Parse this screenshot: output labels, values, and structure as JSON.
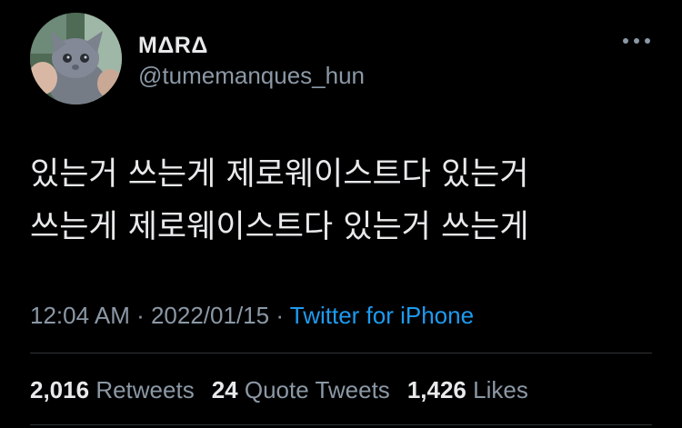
{
  "user": {
    "display_name": "MΔRΔ",
    "handle": "@tumemanques_hun",
    "avatar_icon": "kitten-photo-avatar"
  },
  "more_icon": "more-horizontal-icon",
  "tweet": {
    "text": "있는거 쓰는게 제로웨이스트다 있는거\n쓰는게 제로웨이스트다 있는거 쓰는게"
  },
  "meta": {
    "time": "12:04 AM",
    "sep1": " · ",
    "date": "2022/01/15",
    "sep2": " · ",
    "source": "Twitter for iPhone"
  },
  "stats": {
    "retweets_count": "2,016",
    "retweets_label": "Retweets",
    "quotes_count": "24",
    "quotes_label": "Quote Tweets",
    "likes_count": "1,426",
    "likes_label": "Likes"
  },
  "colors": {
    "background": "#000000",
    "primary_text": "#e7e9ea",
    "secondary_text": "#8b98a5",
    "link": "#1d9bf0",
    "divider": "#2f3336"
  }
}
